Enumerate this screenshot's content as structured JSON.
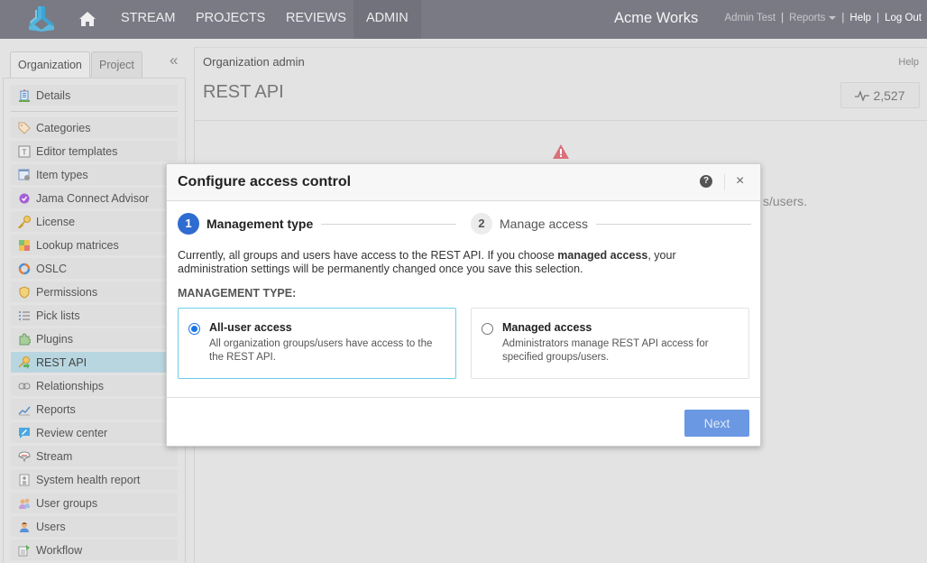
{
  "topbar": {
    "logo_icon": "jama-logo-icon",
    "home_icon": "home-icon",
    "nav": [
      {
        "label": "STREAM"
      },
      {
        "label": "PROJECTS"
      },
      {
        "label": "REVIEWS"
      },
      {
        "label": "ADMIN",
        "active": true
      }
    ],
    "brand": "Acme Works",
    "user_name": "Admin Test",
    "reports_label": "Reports",
    "help_label": "Help",
    "logout_label": "Log Out",
    "separator": "|"
  },
  "sidebar": {
    "tabs": [
      {
        "label": "Organization",
        "active": true
      },
      {
        "label": "Project",
        "active": false
      }
    ],
    "collapse_glyph": "«",
    "items": [
      {
        "label": "Details",
        "icon": "building-icon"
      },
      {
        "label": "Categories",
        "icon": "tag-icon"
      },
      {
        "label": "Editor templates",
        "icon": "template-icon"
      },
      {
        "label": "Item types",
        "icon": "item-types-icon"
      },
      {
        "label": "Jama Connect Advisor",
        "icon": "advisor-badge-icon"
      },
      {
        "label": "License",
        "icon": "key-icon"
      },
      {
        "label": "Lookup matrices",
        "icon": "matrix-icon"
      },
      {
        "label": "OSLC",
        "icon": "oslc-ring-icon"
      },
      {
        "label": "Permissions",
        "icon": "shield-icon"
      },
      {
        "label": "Pick lists",
        "icon": "list-icon"
      },
      {
        "label": "Plugins",
        "icon": "puzzle-icon"
      },
      {
        "label": "REST API",
        "icon": "key-arrow-icon",
        "selected": true
      },
      {
        "label": "Relationships",
        "icon": "link-icon"
      },
      {
        "label": "Reports",
        "icon": "chart-line-icon"
      },
      {
        "label": "Review center",
        "icon": "review-pencil-icon"
      },
      {
        "label": "Stream",
        "icon": "speech-bubble-icon"
      },
      {
        "label": "System health report",
        "icon": "health-report-icon"
      },
      {
        "label": "User groups",
        "icon": "user-group-icon"
      },
      {
        "label": "Users",
        "icon": "user-icon"
      },
      {
        "label": "Workflow",
        "icon": "workflow-icon"
      }
    ]
  },
  "main": {
    "breadcrumb": "Organization admin",
    "help_label": "Help",
    "title": "REST API",
    "activity_count": "2,527",
    "background_text": "s/users."
  },
  "modal": {
    "title": "Configure access control",
    "help_glyph": "?",
    "close_glyph": "×",
    "steps": [
      {
        "number": "1",
        "label": "Management type",
        "active": true
      },
      {
        "number": "2",
        "label": "Manage access",
        "active": false
      }
    ],
    "description_pre": "Currently, all groups and users have access to the REST API. If you choose ",
    "description_bold": "managed access",
    "description_post": ", your administration settings will be permanently changed once you save this selection.",
    "management_type_label": "MANAGEMENT TYPE:",
    "options": [
      {
        "title": "All-user access",
        "description": "All organization groups/users have access to the the REST API.",
        "selected": true
      },
      {
        "title": "Managed access",
        "description": "Administrators manage REST API access for specified groups/users.",
        "selected": false
      }
    ],
    "next_label": "Next",
    "colors": {
      "accent": "#2f6cd0",
      "selected_border": "#6fcde6",
      "next_button": "#6a98e2",
      "radio": "#1a73e8"
    }
  }
}
